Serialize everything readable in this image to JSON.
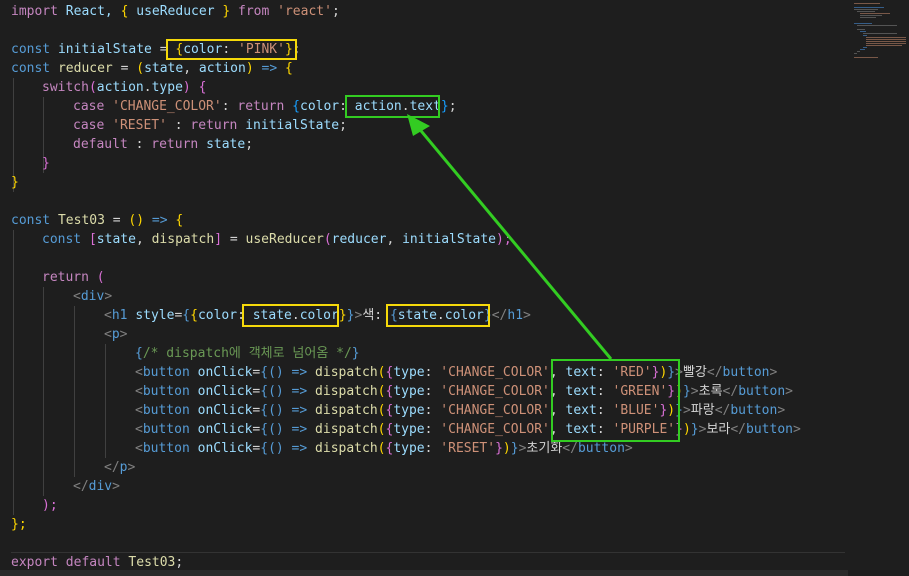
{
  "code": {
    "l1": [
      "import",
      " React, ",
      "{",
      " useReducer ",
      "}",
      " from ",
      "'react'",
      ";"
    ],
    "l3": [
      "const",
      " ",
      "initialState",
      " = ",
      "{",
      "color",
      ": ",
      "'PINK'",
      "}",
      ";"
    ],
    "l4": [
      "const",
      " ",
      "reducer",
      " = ",
      "(",
      "state",
      ", ",
      "action",
      ")",
      " => ",
      "{"
    ],
    "l5": [
      "switch",
      "(",
      "action",
      ".",
      "type",
      ")",
      " ",
      "{"
    ],
    "l6": [
      "case",
      " ",
      "'CHANGE_COLOR'",
      ": ",
      "return",
      " ",
      "{",
      "color",
      ": ",
      "action",
      ".",
      "text",
      "}",
      ";"
    ],
    "l7": [
      "case",
      " ",
      "'RESET'",
      " : ",
      "return",
      " ",
      "initialState",
      ";"
    ],
    "l8": [
      "default",
      " : ",
      "return",
      " ",
      "state",
      ";"
    ],
    "l9": [
      "}"
    ],
    "l10": [
      "}"
    ],
    "l12": [
      "const",
      " ",
      "Test03",
      " = ",
      "()",
      " => ",
      "{"
    ],
    "l13": [
      "const",
      " ",
      "[",
      "state",
      ", ",
      "dispatch",
      "]",
      " = ",
      "useReducer",
      "(",
      "reducer",
      ", ",
      "initialState",
      ");"
    ],
    "l15": [
      "return",
      " ",
      "("
    ],
    "l16": [
      "<",
      "div",
      ">"
    ],
    "l17": [
      "<",
      "h1",
      " ",
      "style",
      "=",
      "{",
      "{",
      "color",
      ": ",
      "state",
      ".",
      "color",
      "}",
      "}",
      ">",
      "색: ",
      "{",
      "state",
      ".",
      "color",
      "}",
      "</",
      "h1",
      ">"
    ],
    "l18": [
      "<",
      "p",
      ">"
    ],
    "l19": [
      "{",
      "/* dispatch에 객체로 넘어옴 */",
      "}"
    ],
    "l20": [
      "<",
      "button",
      " ",
      "onClick",
      "=",
      "{",
      "() => ",
      "dispatch",
      "(",
      "{",
      "type",
      ": ",
      "'CHANGE_COLOR'",
      ", ",
      "text",
      ": ",
      "'RED'",
      "}",
      ")",
      "}",
      ">",
      "빨강",
      "</",
      "button",
      ">"
    ],
    "l21": [
      "<",
      "button",
      " ",
      "onClick",
      "=",
      "{",
      "() => ",
      "dispatch",
      "(",
      "{",
      "type",
      ": ",
      "'CHANGE_COLOR'",
      ", ",
      "text",
      ": ",
      "'GREEN'",
      "}",
      ")",
      "}",
      ">",
      "초록",
      "</",
      "button",
      ">"
    ],
    "l22": [
      "<",
      "button",
      " ",
      "onClick",
      "=",
      "{",
      "() => ",
      "dispatch",
      "(",
      "{",
      "type",
      ": ",
      "'CHANGE_COLOR'",
      ", ",
      "text",
      ": ",
      "'BLUE'",
      "}",
      ")",
      "}",
      ">",
      "파랑",
      "</",
      "button",
      ">"
    ],
    "l23": [
      "<",
      "button",
      " ",
      "onClick",
      "=",
      "{",
      "() => ",
      "dispatch",
      "(",
      "{",
      "type",
      ": ",
      "'CHANGE_COLOR'",
      ", ",
      "text",
      ": ",
      "'PURPLE'",
      "}",
      ")",
      "}",
      ">",
      "보라",
      "</",
      "button",
      ">"
    ],
    "l24": [
      "<",
      "button",
      " ",
      "onClick",
      "=",
      "{",
      "() => ",
      "dispatch",
      "(",
      "{",
      "type",
      ": ",
      "'RESET'",
      "}",
      ")",
      "}",
      ">",
      "초기화",
      "</",
      "button",
      ">"
    ],
    "l25": [
      "</",
      "p",
      ">"
    ],
    "l26": [
      "</",
      "div",
      ">"
    ],
    "l27": [
      ");"
    ],
    "l28": [
      "};"
    ],
    "l30": [
      "export",
      " ",
      "default",
      " ",
      "Test03",
      ";"
    ]
  },
  "colors": {
    "editor_bg": "#1e1e1e",
    "highlight_yellow": "#f5d90a",
    "highlight_green": "#33cc22"
  }
}
